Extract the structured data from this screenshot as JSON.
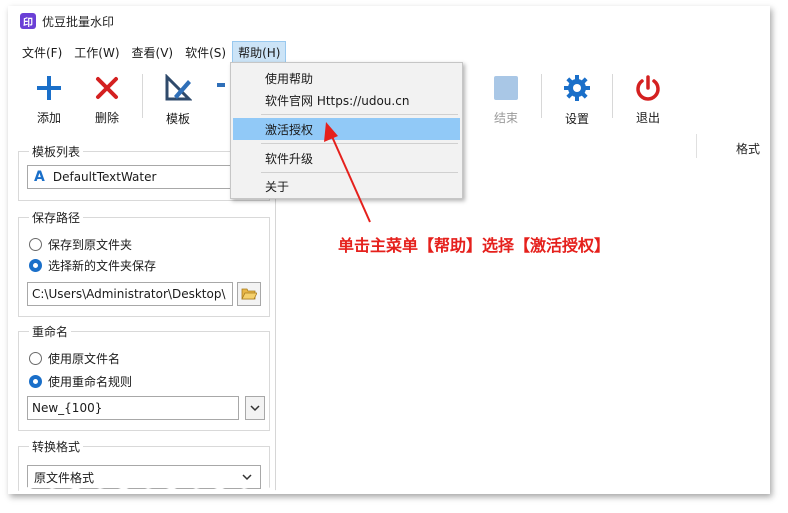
{
  "window": {
    "logo_text": "印",
    "title": "优豆批量水印"
  },
  "menubar": {
    "file": "文件(F)",
    "work": "工作(W)",
    "view": "查看(V)",
    "software": "软件(S)",
    "help": "帮助(H)"
  },
  "toolbar": {
    "add": "添加",
    "delete": "删除",
    "template": "模板",
    "stop": "结束",
    "settings": "设置",
    "exit": "退出"
  },
  "help_menu": {
    "items": [
      "使用帮助",
      "软件官网 Https://udou.cn",
      "激活授权",
      "软件升级",
      "关于"
    ],
    "highlighted": "激活授权"
  },
  "left_panel": {
    "template_list": {
      "title": "模板列表",
      "selected": "DefaultTextWater",
      "icon_letter": "A"
    },
    "save_path": {
      "title": "保存路径",
      "option_original": "保存到原文件夹",
      "option_new": "选择新的文件夹保存",
      "selected": "option_new",
      "path": "C:\\Users\\Administrator\\Desktop\\"
    },
    "rename": {
      "title": "重命名",
      "option_original": "使用原文件名",
      "option_rule": "使用重命名规则",
      "selected": "option_rule",
      "rule": "New_{100}"
    },
    "convert_format": {
      "title": "转换格式",
      "selected": "原文件格式"
    }
  },
  "table": {
    "format_header": "格式"
  },
  "annotation": {
    "text": "单击主菜单【帮助】选择【激活授权】",
    "color": "#e5201c"
  },
  "colors": {
    "accent": "#1a6fc9",
    "highlight": "#91c9f7",
    "brand": "#6a3fd6"
  }
}
